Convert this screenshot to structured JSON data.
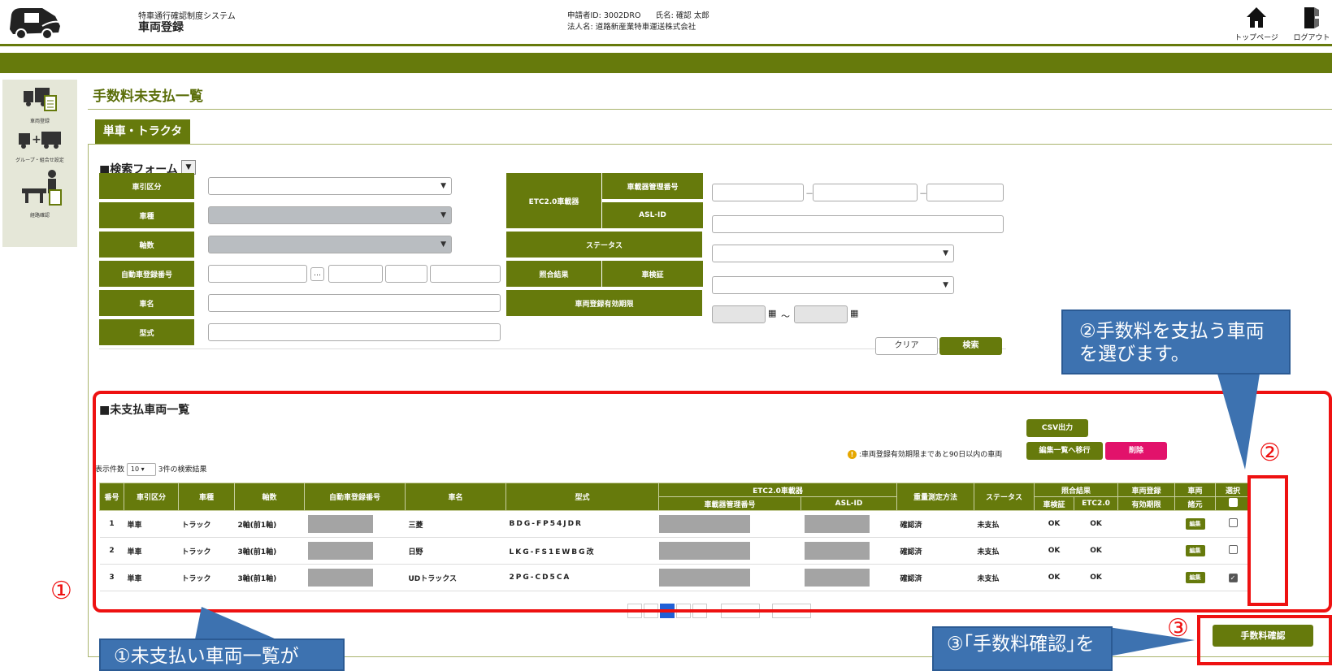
{
  "header": {
    "system_name": "特車通行確認制度システム",
    "page_label": "車両登録",
    "applicant_id_label": "申請者ID:",
    "applicant_id": "3002DRO",
    "name_label": "氏名:",
    "name": "確認 太郎",
    "corp_label": "法人名:",
    "corp_name": "道路新産業特車運送株式会社",
    "top_page": "トップページ",
    "logout": "ログアウト"
  },
  "nav": {
    "items": [
      {
        "label": "車両登録",
        "icon": "truck-document-icon"
      },
      {
        "label": "グループ・組合せ設定",
        "icon": "truck-combination-icon"
      },
      {
        "label": "経路確認",
        "icon": "route-person-icon"
      }
    ]
  },
  "page": {
    "title": "手数料未支払一覧",
    "tab": "単車・トラクタ"
  },
  "search": {
    "heading": "■検索フォーム",
    "toggle": "▼",
    "labels": {
      "tow_type": "車引区分",
      "vehicle_type": "車種",
      "axles": "軸数",
      "reg_number": "自動車登録番号",
      "vehicle_name": "車名",
      "model": "型式",
      "etc": "ETC2.0車載器",
      "device_number": "車載器管理番号",
      "asl_id": "ASL-ID",
      "status": "ステータス",
      "match_result": "照合結果",
      "inspection": "車検証",
      "validity": "車両登録有効期限"
    },
    "dots_button": "…",
    "dash": "－",
    "range_sep": "～",
    "clear_button": "クリア",
    "search_button": "検索"
  },
  "list": {
    "heading": "■未支払車両一覧",
    "csv_button": "CSV出力",
    "move_button": "編集一覧へ移行",
    "delete_button": "削除",
    "legend_badge": "!",
    "legend_note": ":車両登録有効期限まであと90日以内の車両",
    "per_page_label": "表示件数",
    "per_page": "10",
    "result_count": "3件の検索結果",
    "columns": {
      "no": "番号",
      "tow": "車引区分",
      "type": "車種",
      "axles": "軸数",
      "reg": "自動車登録番号",
      "name": "車名",
      "model": "型式",
      "etc_group": "ETC2.0車載器",
      "device": "車載器管理番号",
      "asl": "ASL-ID",
      "weight": "重量測定方法",
      "status": "ステータス",
      "match_group": "照合結果",
      "inspection": "車検証",
      "etc20": "ETC2.0",
      "validity_l1": "車両登録",
      "validity_l2": "有効期限",
      "specs_l1": "車両",
      "specs_l2": "諸元",
      "select": "選択"
    },
    "rows": [
      {
        "no": "1",
        "tow": "単車",
        "type": "トラック",
        "axles": "2軸(前1軸)",
        "name": "三菱",
        "model": "BDG-FP54JDR",
        "weight": "確認済",
        "status": "未支払",
        "inspection": "OK",
        "etc20": "OK",
        "edit": "編集",
        "checked": false
      },
      {
        "no": "2",
        "tow": "単車",
        "type": "トラック",
        "axles": "3軸(前1軸)",
        "name": "日野",
        "model": "LKG-FS1EWBG改",
        "weight": "確認済",
        "status": "未支払",
        "inspection": "OK",
        "etc20": "OK",
        "edit": "編集",
        "checked": false
      },
      {
        "no": "3",
        "tow": "単車",
        "type": "トラック",
        "axles": "3軸(前1軸)",
        "name": "UDトラックス",
        "model": "2PG-CD5CA",
        "weight": "確認済",
        "status": "未支払",
        "inspection": "OK",
        "etc20": "OK",
        "edit": "編集",
        "checked": true
      }
    ],
    "fee_button": "手数料確認"
  },
  "annotations": {
    "num1": "①",
    "num2": "②",
    "num3": "③",
    "callout1": "①未支払い車両一覧が",
    "callout2_l1": "②手数料を支払う車両",
    "callout2_l2": "を選びます。",
    "callout3": "③｢手数料確認｣を"
  },
  "colors": {
    "accent": "#667a0c",
    "annotation_red": "#ee1111",
    "callout_blue": "#3d72b0",
    "delete_pink": "#e2126b"
  }
}
